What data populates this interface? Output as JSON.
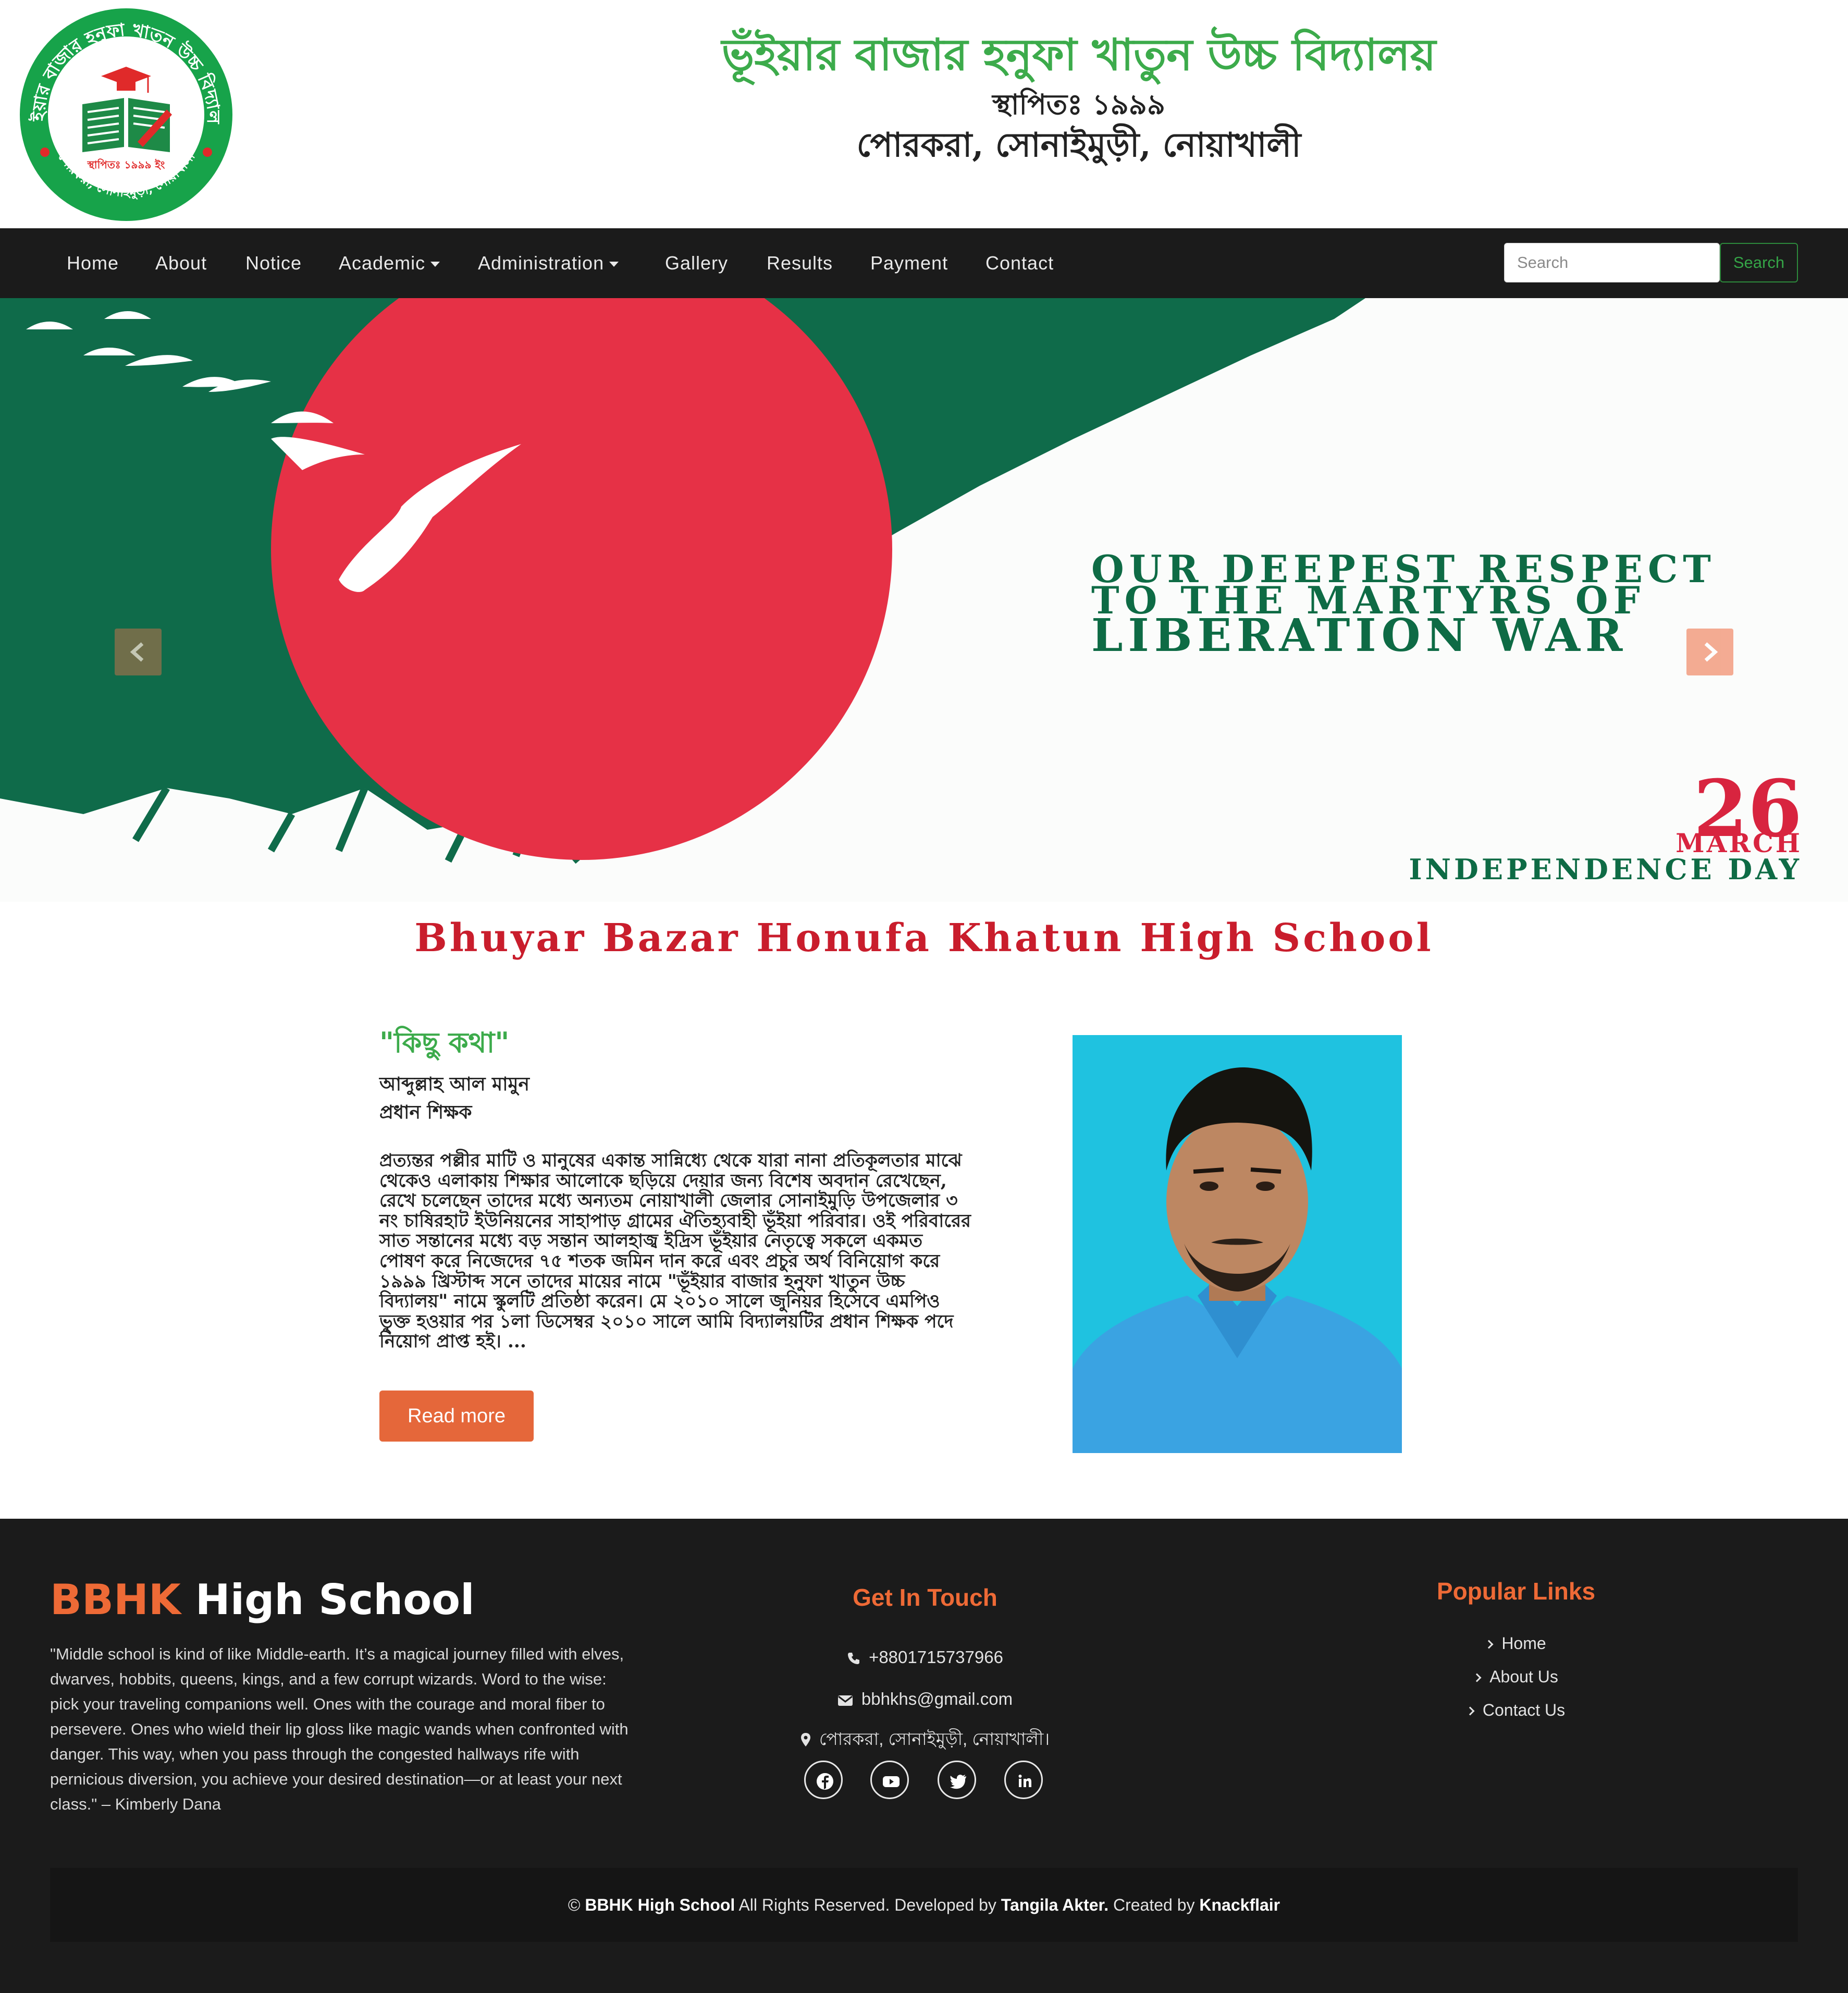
{
  "header": {
    "logo": {
      "text_top": "ভূঁইয়ার বাজার হনুফা খাতুন উচ্চ বিদ্যালয়",
      "text_inner": "স্থাপিতঃ ১৯৯৯ ইং",
      "text_bottom": "পোরকরা, সোনাইমুড়ী, নোয়াখালী",
      "colors": {
        "ring": "#17a34a",
        "accent": "#e02a2a",
        "book": "#1e8a47"
      }
    },
    "title": "ভূঁইয়ার বাজার হনুফা খাতুন উচ্চ বিদ্যালয়",
    "established": "স্থাপিতঃ ১৯৯৯",
    "location": "পোরকরা, সোনাইমুড়ী, নোয়াখালী"
  },
  "nav": {
    "items": [
      {
        "label": "Home"
      },
      {
        "label": "About"
      },
      {
        "label": "Notice"
      },
      {
        "label": "Academic",
        "dropdown": true
      },
      {
        "label": "Administration",
        "dropdown": true
      },
      {
        "label": "Gallery"
      },
      {
        "label": "Results"
      },
      {
        "label": "Payment"
      },
      {
        "label": "Contact"
      }
    ],
    "search_placeholder": "Search",
    "search_button": "Search"
  },
  "slider": {
    "headline_1": "OUR DEEPEST RESPECT",
    "headline_2": "TO THE MARTYRS OF",
    "headline_3": "LIBERATION WAR",
    "date_day": "26",
    "date_month": "MARCH",
    "holiday": "INDEPENDENCE DAY",
    "banner": "Bhuyar Bazar Honufa Khatun High School",
    "colors": {
      "green": "#0f6b4a",
      "red": "#e63146"
    }
  },
  "message": {
    "title": "\"কিছু কথা\"",
    "name": "আব্দুল্লাহ আল মামুন",
    "role": "প্রধান শিক্ষক",
    "body": "প্রত্যন্তর পল্লীর মাটি ও মানুষের একান্ত সান্নিধ্যে থেকে যারা নানা প্রতিকূলতার মাঝে থেকেও এলাকায় শিক্ষার আলোকে ছড়িয়ে দেয়ার জন্য বিশেষ অবদান রেখেছেন, রেখে চলেছেন তাদের মধ্যে অন্যতম নোয়াখালী জেলার সোনাইমুড়ি উপজেলার ৩ নং চাষিরহাট ইউনিয়নের সাহাপাড় গ্রামের ঐতিহ্যবাহী ভূঁইয়া পরিবার। ওই পরিবারের সাত সন্তানের মধ্যে বড় সন্তান আলহাজ্ব ইদ্রিস ভূঁইয়ার নেতৃত্বে সকলে একমত পোষণ করে নিজেদের ৭৫ শতক জমিন দান করে এবং প্রচুর অর্থ বিনিয়োগ করে ১৯৯৯ খ্রিস্টাব্দ সনে তাদের মায়ের নামে \"ভূঁইয়ার বাজার হনুফা খাতুন উচ্চ বিদ্যালয়\" নামে স্কুলটি প্রতিষ্ঠা করেন। মে ২০১০ সালে জুনিয়র হিসেবে এমপিও ভুক্ত হওয়ার পর ১লা ডিসেম্বর ২০১০ সালে আমি বিদ্যালয়টির প্রধান শিক্ষক পদে নিয়োগ প্রাপ্ত হই। ...",
    "read_more": "Read more"
  },
  "footer": {
    "brand_accent": "BBHK",
    "brand_rest": "High School",
    "quote": "\"Middle school is kind of like Middle-earth. It’s a magical journey filled with elves, dwarves, hobbits, queens, kings, and a few corrupt wizards. Word to the wise: pick your traveling companions well. Ones with the courage and moral fiber to persevere. Ones who wield their lip gloss like magic wands when confronted with danger. This way, when you pass through the congested hallways rife with pernicious diversion, you achieve your desired destination—or at least your next class.\" – Kimberly Dana",
    "contact_heading": "Get In Touch",
    "phone": "+8801715737966",
    "email": "bbhkhs@gmail.com",
    "address": "পোরকরা, সোনাইমুড়ী, নোয়াখালী।",
    "social": [
      "facebook-icon",
      "youtube-icon",
      "twitter-icon",
      "linkedin-icon"
    ],
    "links_heading": "Popular Links",
    "links": [
      "Home",
      "About Us",
      "Contact Us"
    ],
    "copyright": {
      "symbol": "©",
      "site": "BBHK High School",
      "rights": "All Rights Reserved. Developed by",
      "developer": "Tangila Akter.",
      "created": "Created by",
      "company": "Knackflair"
    },
    "colors": {
      "accent": "#ee6a36",
      "background": "#1b1b1b"
    }
  }
}
